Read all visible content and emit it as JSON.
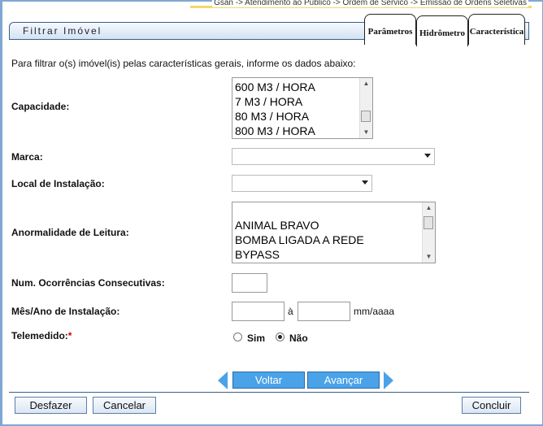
{
  "breadcrumb": "Gsan -> Atendimento ao Publico -> Ordem de Servico -> Emissao de Ordens Seletivas",
  "title": "Filtrar Imóvel",
  "tabs": [
    {
      "label": "Parâmetros"
    },
    {
      "label": "Hidrômetro"
    },
    {
      "label": "Característica"
    }
  ],
  "intro": "Para filtrar o(s) imóvel(is) pelas características gerais, informe os dados abaixo:",
  "capacidade": {
    "label": "Capacidade:",
    "options": [
      "600 M3 / HORA",
      "7 M3 / HORA",
      "80 M3 / HORA",
      "800 M3 / HORA"
    ]
  },
  "marca": {
    "label": "Marca:",
    "value": ""
  },
  "local_instalacao": {
    "label": "Local de Instalação:",
    "value": ""
  },
  "anormalidade": {
    "label": "Anormalidade de Leitura:",
    "options": [
      "",
      "ANIMAL BRAVO",
      "BOMBA LIGADA A REDE",
      "BYPASS"
    ]
  },
  "num_ocorrencias": {
    "label": "Num. Ocorrências Consecutivas:",
    "value": ""
  },
  "mes_ano": {
    "label": "Mês/Ano de Instalação:",
    "from": "",
    "to": "",
    "sep": "à",
    "format": "mm/aaaa"
  },
  "telemedido": {
    "label": "Telemedido:",
    "required_mark": "*",
    "sim": "Sim",
    "nao": "Não",
    "selected": "Não"
  },
  "nav": {
    "voltar": "Voltar",
    "avancar": "Avançar"
  },
  "buttons": {
    "desfazer": "Desfazer",
    "cancelar": "Cancelar",
    "concluir": "Concluir"
  },
  "colors": {
    "accent": "#4aa3e8",
    "border": "#3a5f8c",
    "required": "#cc0000"
  }
}
